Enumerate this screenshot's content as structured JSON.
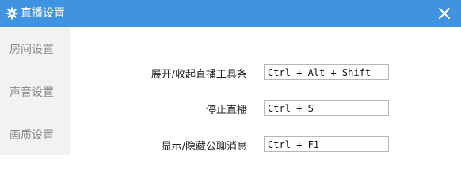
{
  "window": {
    "title": "直播设置"
  },
  "icons": {
    "title": "gear-icon",
    "close": "close-icon"
  },
  "colors": {
    "titlebar": "#3f93e0",
    "sidebar_bg": "#f2f2f2"
  },
  "sidebar": {
    "items": [
      {
        "label": "房间设置"
      },
      {
        "label": "声音设置"
      },
      {
        "label": "画质设置"
      }
    ]
  },
  "hotkeys": [
    {
      "label": "展开/收起直播工具条",
      "value": "Ctrl + Alt + Shift"
    },
    {
      "label": "停止直播",
      "value": "Ctrl + S"
    },
    {
      "label": "显示/隐藏公聊消息",
      "value": "Ctrl + F1"
    }
  ]
}
